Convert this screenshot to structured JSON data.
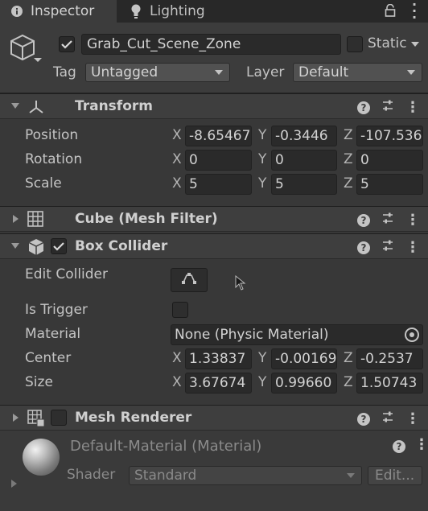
{
  "tabs": [
    {
      "label": "Inspector",
      "icon": "info-icon"
    },
    {
      "label": "Lighting",
      "icon": "lightbulb-icon"
    }
  ],
  "object": {
    "active": true,
    "name": "Grab_Cut_Scene_Zone",
    "static_label": "Static",
    "static_checked": false,
    "tag_label": "Tag",
    "tag_value": "Untagged",
    "layer_label": "Layer",
    "layer_value": "Default"
  },
  "transform": {
    "title": "Transform",
    "rows": [
      {
        "label": "Position",
        "x": "-8.65467",
        "y": "-0.3446",
        "z": "-107.536"
      },
      {
        "label": "Rotation",
        "x": "0",
        "y": "0",
        "z": "0"
      },
      {
        "label": "Scale",
        "x": "5",
        "y": "5",
        "z": "5"
      }
    ]
  },
  "axis_labels": {
    "x": "X",
    "y": "Y",
    "z": "Z"
  },
  "mesh_filter": {
    "title": "Cube (Mesh Filter)"
  },
  "box_collider": {
    "title": "Box Collider",
    "enabled": true,
    "edit_collider_label": "Edit Collider",
    "is_trigger_label": "Is Trigger",
    "is_trigger": false,
    "material_label": "Material",
    "material_value": "None (Physic Material)",
    "center": {
      "label": "Center",
      "x": "1.33837",
      "y": "-0.00169",
      "z": "-0.2537"
    },
    "size": {
      "label": "Size",
      "x": "3.67674",
      "y": "0.99660",
      "z": "1.50743"
    }
  },
  "mesh_renderer": {
    "title": "Mesh Renderer",
    "enabled": false
  },
  "material": {
    "name": "Default-Material (Material)",
    "shader_label": "Shader",
    "shader_value": "Standard",
    "edit_label": "Edit..."
  },
  "colors": {
    "background": "#383838",
    "field": "#2a2a2a",
    "tabbar": "#282828"
  }
}
